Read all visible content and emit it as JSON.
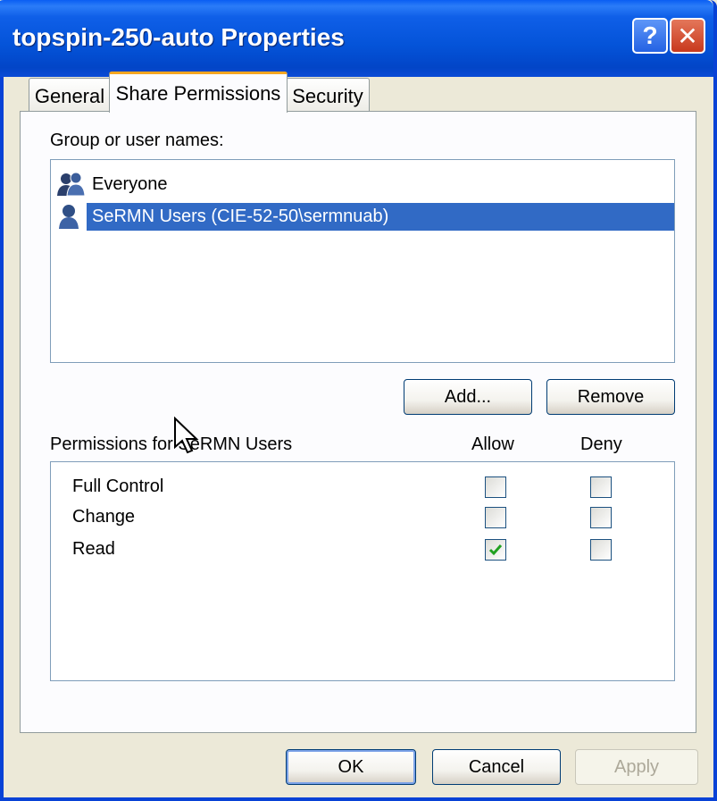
{
  "window": {
    "title": "topspin-250-auto Properties",
    "help_label": "?",
    "close_label": "✕"
  },
  "tabs": [
    {
      "label": "General",
      "selected": false
    },
    {
      "label": "Share Permissions",
      "selected": true
    },
    {
      "label": "Security",
      "selected": false
    }
  ],
  "users": {
    "heading": "Group or user names:",
    "items": [
      {
        "label": "Everyone",
        "icon": "group-icon",
        "selected": false
      },
      {
        "label": "SeRMN Users (CIE-52-50\\sermnuab)",
        "icon": "user-icon",
        "selected": true
      }
    ],
    "add_label": "Add...",
    "remove_label": "Remove"
  },
  "permissions": {
    "heading": "Permissions for SeRMN Users",
    "allow_header": "Allow",
    "deny_header": "Deny",
    "rows": [
      {
        "name": "Full Control",
        "allow": false,
        "deny": false
      },
      {
        "name": "Change",
        "allow": false,
        "deny": false
      },
      {
        "name": "Read",
        "allow": true,
        "deny": false
      }
    ]
  },
  "footer": {
    "ok_label": "OK",
    "cancel_label": "Cancel",
    "apply_label": "Apply"
  },
  "colors": {
    "titlebar": "#0453d8",
    "selection": "#316ac5",
    "tab_accent": "#f6a621",
    "check": "#21a121"
  }
}
